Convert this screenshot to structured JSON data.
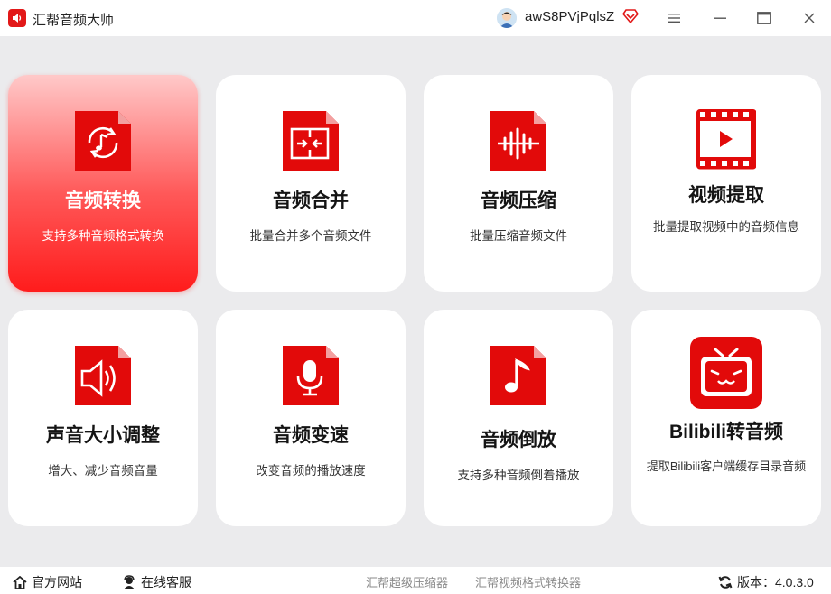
{
  "app": {
    "title": "汇帮音频大师",
    "username": "awS8PVjPqlsZ",
    "brand_color": "#e21818"
  },
  "window_controls": [
    "menu-icon",
    "minimize-icon",
    "maximize-icon",
    "close-icon"
  ],
  "cards": [
    {
      "title": "音频转换",
      "desc": "支持多种音频格式转换",
      "icon": "audio-convert-icon",
      "active": true
    },
    {
      "title": "音频合并",
      "desc": "批量合并多个音频文件",
      "icon": "audio-merge-icon",
      "active": false
    },
    {
      "title": "音频压缩",
      "desc": "批量压缩音频文件",
      "icon": "audio-compress-icon",
      "active": false
    },
    {
      "title": "视频提取",
      "desc": "批量提取视频中的音频信息",
      "icon": "video-extract-icon",
      "active": false
    },
    {
      "title": "声音大小调整",
      "desc": "增大、减少音频音量",
      "icon": "volume-icon",
      "active": false
    },
    {
      "title": "音频变速",
      "desc": "改变音频的播放速度",
      "icon": "microphone-icon",
      "active": false
    },
    {
      "title": "音频倒放",
      "desc": "支持多种音频倒着播放",
      "icon": "music-note-icon",
      "active": false
    },
    {
      "title": "Bilibili转音频",
      "desc": "提取Bilibili客户端缓存目录音频",
      "icon": "bilibili-tv-icon",
      "active": false
    }
  ],
  "footer": {
    "website": "官方网站",
    "support": "在线客服",
    "link1": "汇帮超级压缩器",
    "link2": "汇帮视频格式转换器",
    "version_label": "版本：",
    "version": "4.0.3.0"
  }
}
